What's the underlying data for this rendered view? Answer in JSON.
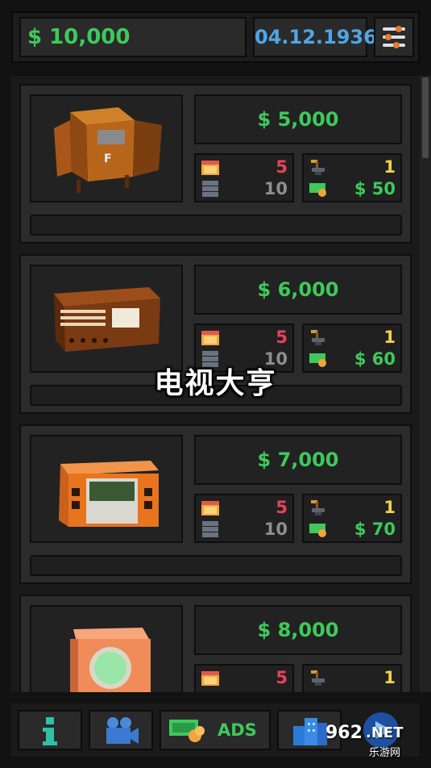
{
  "header": {
    "money": "$ 10,000",
    "date": "04.12.1936",
    "settings_icon": "sliders-icon"
  },
  "items": [
    {
      "price": "$ 5,000",
      "build_days": "5",
      "build_queue": "10",
      "level": "1",
      "income": "$ 50",
      "image": "radio-cabinet-icon"
    },
    {
      "price": "$ 6,000",
      "build_days": "5",
      "build_queue": "10",
      "level": "1",
      "income": "$ 60",
      "image": "wooden-radio-icon"
    },
    {
      "price": "$ 7,000",
      "build_days": "5",
      "build_queue": "10",
      "level": "1",
      "income": "$ 70",
      "image": "orange-tv-icon"
    },
    {
      "price": "$ 8,000",
      "build_days": "5",
      "build_queue": "",
      "level": "1",
      "income": "",
      "image": "round-screen-tv-icon"
    }
  ],
  "bottom": {
    "info_icon": "info-icon",
    "camera_icon": "video-camera-icon",
    "ads_label": "ADS",
    "city_icon": "city-buildings-icon",
    "play_icon": "play-icon"
  },
  "overlay_title": "电视大亨",
  "watermark": {
    "number": "962",
    "net": ".NET",
    "site": "乐游网"
  },
  "colors": {
    "money_green": "#3ec95b",
    "date_blue": "#4ea6e6",
    "stat_red": "#e6435a",
    "stat_yellow": "#f1d24a"
  }
}
